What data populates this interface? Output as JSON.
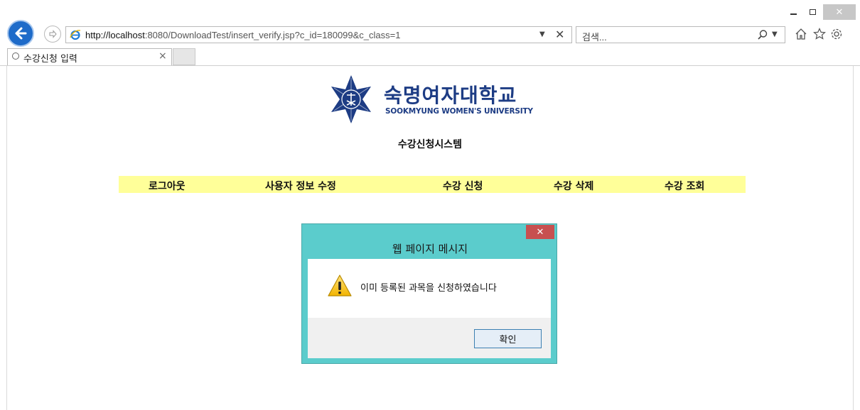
{
  "browser": {
    "url_host": "http://localhost",
    "url_rest": ":8080/DownloadTest/insert_verify.jsp?c_id=180099&c_class=1",
    "search_placeholder": "검색...",
    "tab_title": "수강신청 입력",
    "tab_close": "×",
    "url_close": "✕",
    "win_close": "✕"
  },
  "page": {
    "logo_kr": "숙명여자대학교",
    "logo_en": "SOOKMYUNG WOMEN'S UNIVERSITY",
    "system_title": "수강신청시스템",
    "menu": [
      {
        "label": "로그아웃"
      },
      {
        "label": "사용자 정보 수정"
      },
      {
        "label": "수강 신청"
      },
      {
        "label": "수강 삭제"
      },
      {
        "label": "수강 조회"
      }
    ]
  },
  "dialog": {
    "title": "웹 페이지 메시지",
    "close": "✕",
    "message": "이미 등록된 과목을 신청하였습니다",
    "ok_label": "확인"
  },
  "colors": {
    "menu_bg": "#ffff99",
    "dialog_frame": "#5bcccc",
    "logo_blue": "#1d3c84",
    "close_red": "#c75050"
  }
}
